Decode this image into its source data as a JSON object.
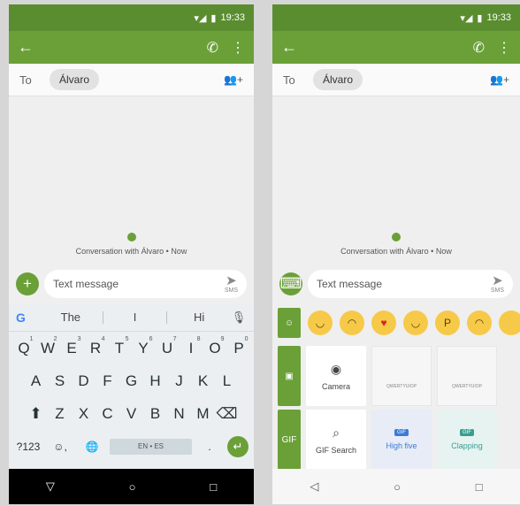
{
  "status": {
    "time": "19:33"
  },
  "appbar": {
    "back_icon": "arrow-left-icon",
    "call_icon": "phone-icon",
    "menu_icon": "more-vert-icon"
  },
  "recipient": {
    "to_label": "To",
    "name": "Álvaro",
    "add_icon": "add-person-icon"
  },
  "conversation": {
    "label": "Conversation with Álvaro • Now"
  },
  "composer": {
    "placeholder": "Text message",
    "send_label": "SMS"
  },
  "keyboard": {
    "suggestions": [
      "The",
      "I",
      "Hi"
    ],
    "row1": [
      {
        "letter": "Q",
        "num": "1"
      },
      {
        "letter": "W",
        "num": "2"
      },
      {
        "letter": "E",
        "num": "3"
      },
      {
        "letter": "R",
        "num": "4"
      },
      {
        "letter": "T",
        "num": "5"
      },
      {
        "letter": "Y",
        "num": "6"
      },
      {
        "letter": "U",
        "num": "7"
      },
      {
        "letter": "I",
        "num": "8"
      },
      {
        "letter": "O",
        "num": "9"
      },
      {
        "letter": "P",
        "num": "0"
      }
    ],
    "row2": [
      "A",
      "S",
      "D",
      "F",
      "G",
      "H",
      "J",
      "K",
      "L"
    ],
    "row3": [
      "Z",
      "X",
      "C",
      "V",
      "B",
      "N",
      "M"
    ],
    "bottom": {
      "numbers": "?123",
      "space": "EN • ES",
      "period": "."
    }
  },
  "media": {
    "emoji_count": 7,
    "tiles": {
      "camera": "Camera",
      "gif_search": "GIF Search",
      "high_five": "High five",
      "clapping": "Clapping"
    },
    "gif_badge": "GIF"
  },
  "colors": {
    "primary": "#6aa037",
    "status": "#5a8d2f"
  }
}
